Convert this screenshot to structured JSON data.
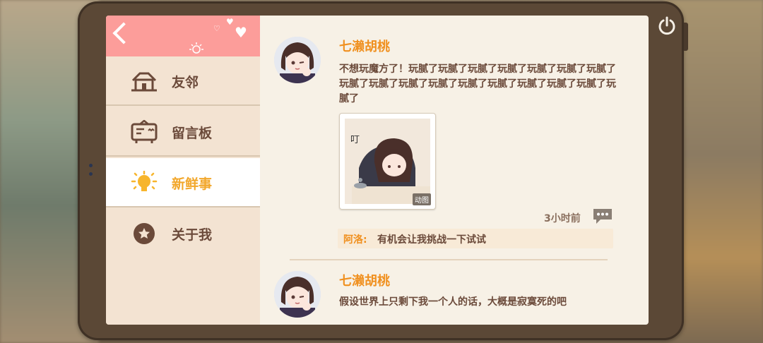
{
  "sidebar": {
    "back_icon": "chevron-left-icon",
    "items": [
      {
        "label": "友邻",
        "icon": "house-icon",
        "active": false
      },
      {
        "label": "留言板",
        "icon": "message-board-icon",
        "active": false
      },
      {
        "label": "新鲜事",
        "icon": "lightbulb-icon",
        "active": true
      },
      {
        "label": "关于我",
        "icon": "star-badge-icon",
        "active": false
      }
    ]
  },
  "feed": {
    "posts": [
      {
        "author": "七濑胡桃",
        "text": "不想玩魔方了！玩腻了玩腻了玩腻了玩腻了玩腻了玩腻了玩腻了玩腻了玩腻了玩腻了玩腻了玩腻了玩腻了玩腻了玩腻了玩腻了玩腻了",
        "image": {
          "caption_glyph": "叮",
          "badge": "动图"
        },
        "time": "3小时前",
        "reply": {
          "name": "阿洛:",
          "text": "有机会让我挑战一下试试"
        }
      },
      {
        "author": "七濑胡桃",
        "text": "假设世界上只剩下我一个人的话，大概是寂寞死的吧"
      }
    ]
  },
  "colors": {
    "accent_orange": "#f0901f",
    "back_bar_pink": "#fc9d9a",
    "text_brown": "#6b4a3a",
    "tablet_frame": "#5b4836"
  }
}
